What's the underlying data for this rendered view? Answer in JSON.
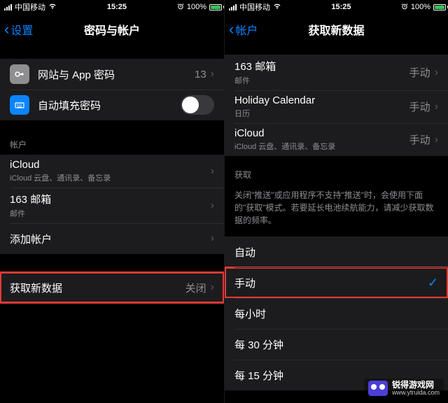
{
  "status": {
    "carrier": "中国移动",
    "time": "15:25",
    "battery_pct": "100%"
  },
  "left": {
    "back": "设置",
    "title": "密码与帐户",
    "rows": {
      "passwords": {
        "label": "网站与 App 密码",
        "value": "13"
      },
      "autofill": {
        "label": "自动填充密码"
      }
    },
    "accounts_header": "帐户",
    "accounts": [
      {
        "title": "iCloud",
        "sub": "iCloud 云盘、通讯录、备忘录"
      },
      {
        "title": "163 邮箱",
        "sub": "邮件"
      },
      {
        "title": "添加帐户"
      }
    ],
    "fetch": {
      "label": "获取新数据",
      "value": "关闭"
    }
  },
  "right": {
    "back": "帐户",
    "title": "获取新数据",
    "accounts": [
      {
        "title": "163 邮箱",
        "sub": "邮件",
        "value": "手动"
      },
      {
        "title": "Holiday Calendar",
        "sub": "日历",
        "value": "手动"
      },
      {
        "title": "iCloud",
        "sub": "iCloud 云盘、通讯录、备忘录",
        "value": "手动"
      }
    ],
    "fetch_header": "获取",
    "fetch_footer": "关闭\"推送\"或应用程序不支持\"推送\"时，会使用下面的\"获取\"模式。若要延长电池续航能力，请减少获取数据的频率。",
    "options": [
      {
        "label": "自动"
      },
      {
        "label": "手动",
        "selected": true
      },
      {
        "label": "每小时"
      },
      {
        "label": "每 30 分钟"
      },
      {
        "label": "每 15 分钟"
      }
    ]
  },
  "watermark": {
    "name": "锐得游戏网",
    "url": "www.ytruida.com"
  }
}
